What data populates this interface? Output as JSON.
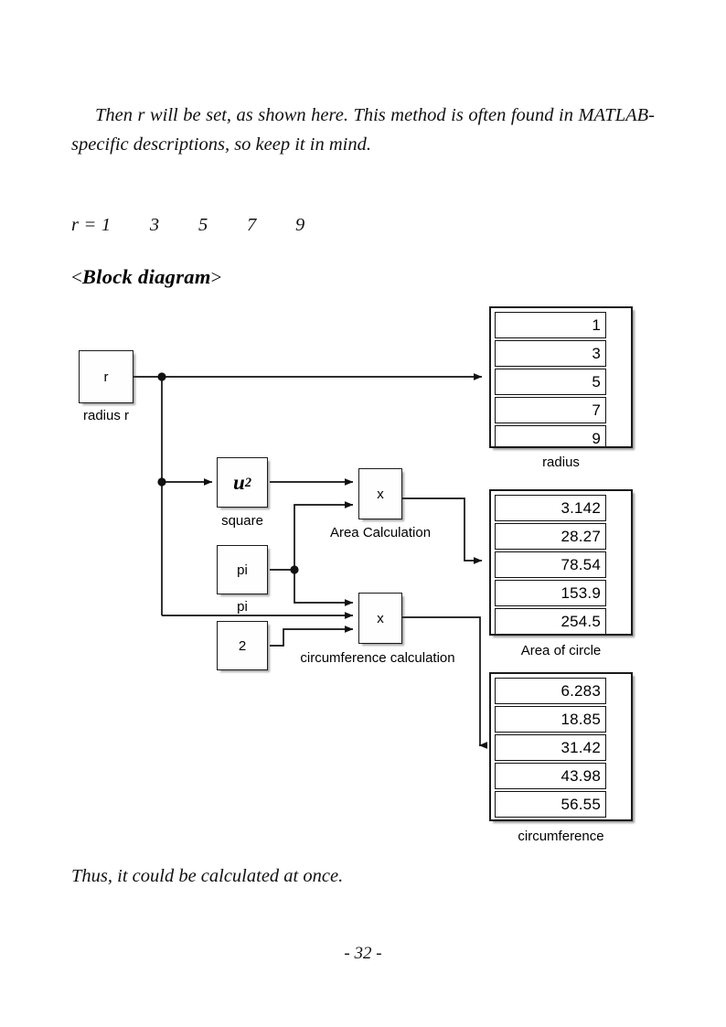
{
  "document": {
    "intro_paragraph": "Then r will be set, as shown here. This method is often found in MATLAB-specific descriptions, so keep it in mind.",
    "r_values_line": "r = 1        3        5        7        9",
    "heading_open_bracket": "<",
    "heading_text": "Block diagram",
    "heading_close_bracket": ">",
    "closing_paragraph": "Thus, it could be calculated at once.",
    "page_number": "- 32 -"
  },
  "diagram": {
    "blocks": {
      "source_r": {
        "text": "r",
        "label": "radius r"
      },
      "square": {
        "text": "u",
        "exponent": "2",
        "label": "square"
      },
      "pi": {
        "text": "pi",
        "label": "pi"
      },
      "two": {
        "text": "2",
        "label": ""
      },
      "area_product": {
        "text": "x",
        "label": "Area Calculation"
      },
      "circumference_product": {
        "text": "x",
        "label": "circumference calculation"
      }
    },
    "displays": [
      {
        "name": "radius",
        "label": "radius",
        "values": [
          "1",
          "3",
          "5",
          "7",
          "9"
        ]
      },
      {
        "name": "area-of-circle",
        "label": "Area of circle",
        "values": [
          "3.142",
          "28.27",
          "78.54",
          "153.9",
          "254.5"
        ]
      },
      {
        "name": "circumference",
        "label": "circumference",
        "values": [
          "6.283",
          "18.85",
          "31.42",
          "43.98",
          "56.55"
        ]
      }
    ]
  },
  "colors": {
    "line": "#111111",
    "block_fill": "#fefefe",
    "page_bg": "#ffffff"
  }
}
